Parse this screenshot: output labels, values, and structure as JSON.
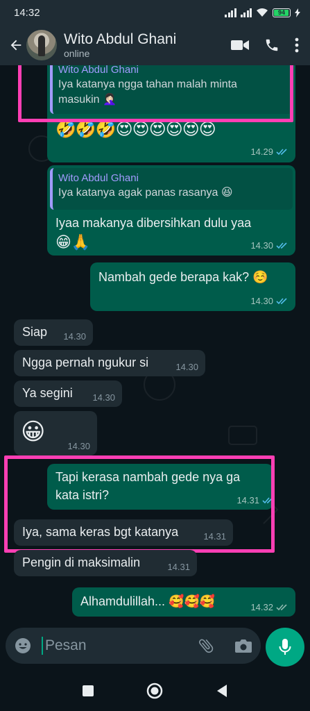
{
  "status_bar": {
    "time": "14:32",
    "battery": "94"
  },
  "header": {
    "contact_name": "Wito Abdul Ghani",
    "contact_status": "online"
  },
  "messages": [
    {
      "type": "out",
      "quote_name": "Wito Abdul Ghani",
      "quote_text_1": "Iya katanya ngga tahan malah minta",
      "quote_text_2": "masukin 🤦🏻‍♀️",
      "emojis": "🤣🤣🤣😍😍😍😍😍😍",
      "time": "14.29"
    },
    {
      "type": "out",
      "quote_name": "Wito Abdul Ghani",
      "quote_text": "Iya katanya agak panas rasanya 😆",
      "text_1": "Iyaa makanya dibersihkan dulu yaa",
      "text_2": "😁🙏",
      "time": "14.30"
    },
    {
      "type": "out",
      "text": "Nambah gede berapa kak? ☺️",
      "time": "14.30"
    },
    {
      "type": "in",
      "text": "Siap",
      "time": "14.30"
    },
    {
      "type": "in",
      "text": "Ngga pernah ngukur si",
      "time": "14.30"
    },
    {
      "type": "in",
      "text": "Ya segini",
      "time": "14.30"
    },
    {
      "type": "in",
      "text": "😀",
      "time": "14.30"
    },
    {
      "type": "out",
      "text_1": "Tapi kerasa nambah gede nya ga",
      "text_2": "kata istri?",
      "time": "14.31"
    },
    {
      "type": "in",
      "text": "Iya, sama keras bgt katanya",
      "time": "14.31"
    },
    {
      "type": "in",
      "text": "Pengin di maksimalin",
      "time": "14.31"
    },
    {
      "type": "out",
      "text": "Alhamdulillah... 🥰🥰🥰",
      "time": "14.32"
    }
  ],
  "composer": {
    "placeholder": "Pesan"
  },
  "colors": {
    "header": "#1f2c34",
    "outgoing": "#005c4b",
    "incoming": "#202c33",
    "accent": "#00a884",
    "highlight": "#ff3fb4",
    "read_tick": "#53bdeb"
  },
  "icons": [
    "back-arrow-icon",
    "video-call-icon",
    "phone-icon",
    "more-options-icon",
    "emoji-icon",
    "attach-icon",
    "camera-icon",
    "mic-icon",
    "nav-recents-icon",
    "nav-home-icon",
    "nav-back-icon"
  ]
}
